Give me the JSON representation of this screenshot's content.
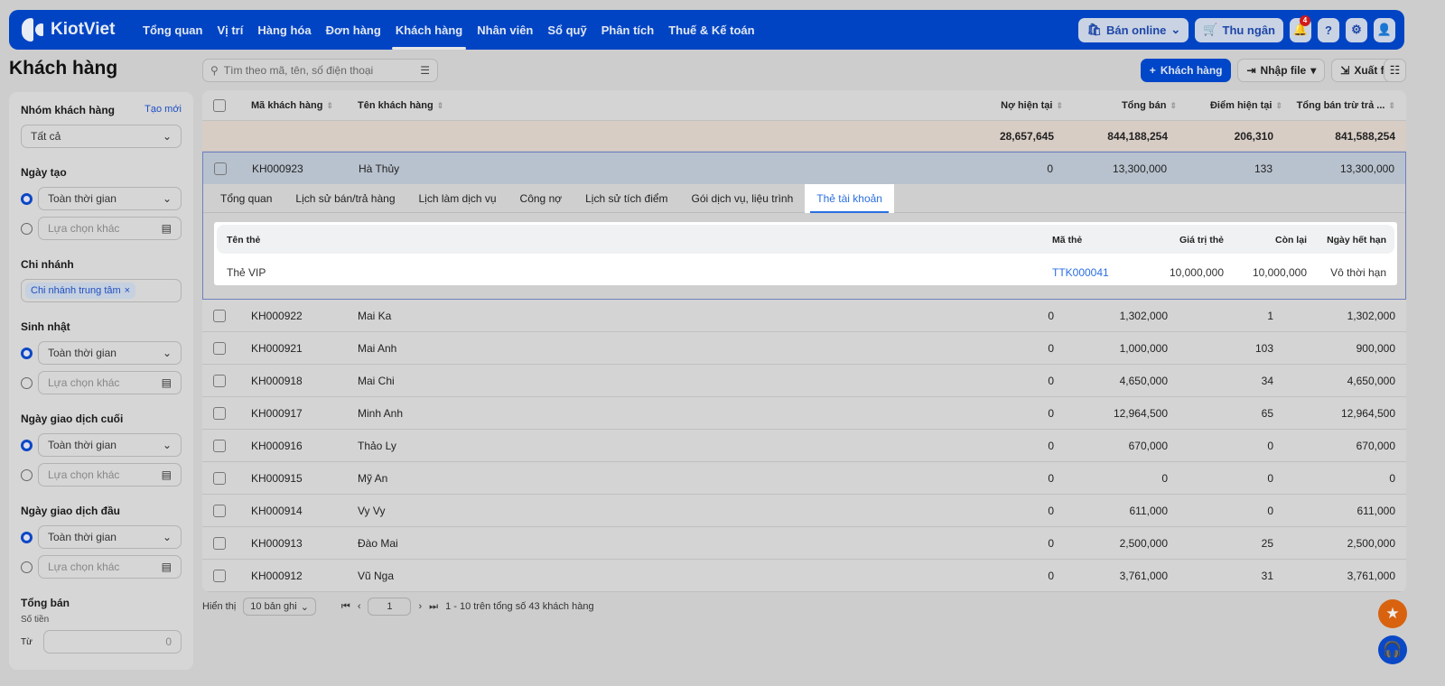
{
  "brand": "KiotViet",
  "nav": [
    "Tổng quan",
    "Vị trí",
    "Hàng hóa",
    "Đơn hàng",
    "Khách hàng",
    "Nhân viên",
    "Sổ quỹ",
    "Phân tích",
    "Thuế & Kế toán"
  ],
  "nav_active": "Khách hàng",
  "topright": {
    "online": "Bán online",
    "cashier": "Thu ngân",
    "notif_count": "4"
  },
  "page_title": "Khách hàng",
  "search": {
    "placeholder": "Tìm theo mã, tên, số điện thoại"
  },
  "actions": {
    "add": "Khách hàng",
    "import": "Nhập file",
    "export": "Xuất file"
  },
  "sidebar": {
    "group": {
      "title": "Nhóm khách hàng",
      "create": "Tạo mới",
      "value": "Tất cả"
    },
    "created": {
      "title": "Ngày tạo",
      "all": "Toàn thời gian",
      "other": "Lựa chọn khác"
    },
    "branch": {
      "title": "Chi nhánh",
      "tag": "Chi nhánh trung tâm"
    },
    "birthday": {
      "title": "Sinh nhật",
      "all": "Toàn thời gian",
      "other": "Lựa chọn khác"
    },
    "last_tx": {
      "title": "Ngày giao dịch cuối",
      "all": "Toàn thời gian",
      "other": "Lựa chọn khác"
    },
    "first_tx": {
      "title": "Ngày giao dịch đầu",
      "all": "Toàn thời gian",
      "other": "Lựa chọn khác"
    },
    "total": {
      "title": "Tổng bán",
      "sub": "Số tiền",
      "from": "Từ",
      "from_value": "0"
    }
  },
  "table": {
    "headers": [
      "Mã khách hàng",
      "Tên khách hàng",
      "Nợ hiện tại",
      "Tổng bán",
      "Điểm hiện tại",
      "Tổng bán trừ trả ..."
    ],
    "summary": [
      "28,657,645",
      "844,188,254",
      "206,310",
      "841,588,254"
    ],
    "selected": [
      "KH000923",
      "Hà Thủy",
      "0",
      "13,300,000",
      "133",
      "13,300,000"
    ],
    "rows": [
      [
        "KH000922",
        "Mai Ka",
        "0",
        "1,302,000",
        "1",
        "1,302,000"
      ],
      [
        "KH000921",
        "Mai Anh",
        "0",
        "1,000,000",
        "103",
        "900,000"
      ],
      [
        "KH000918",
        "Mai Chi",
        "0",
        "4,650,000",
        "34",
        "4,650,000"
      ],
      [
        "KH000917",
        "Minh Anh",
        "0",
        "12,964,500",
        "65",
        "12,964,500"
      ],
      [
        "KH000916",
        "Thảo Ly",
        "0",
        "670,000",
        "0",
        "670,000"
      ],
      [
        "KH000915",
        "Mỹ An",
        "0",
        "0",
        "0",
        "0"
      ],
      [
        "KH000914",
        "Vy Vy",
        "0",
        "611,000",
        "0",
        "611,000"
      ],
      [
        "KH000913",
        "Đào Mai",
        "0",
        "2,500,000",
        "25",
        "2,500,000"
      ],
      [
        "KH000912",
        "Vũ Nga",
        "0",
        "3,761,000",
        "31",
        "3,761,000"
      ]
    ]
  },
  "detail": {
    "tabs": [
      "Tổng quan",
      "Lịch sử bán/trả hàng",
      "Lịch làm dịch vụ",
      "Công nợ",
      "Lịch sử tích điểm",
      "Gói dịch vụ, liệu trình",
      "Thẻ tài khoản"
    ],
    "active_tab": "Thẻ tài khoản",
    "card_headers": [
      "Tên thẻ",
      "Mã thẻ",
      "Giá trị thẻ",
      "Còn lại",
      "Ngày hết hạn"
    ],
    "card_row": [
      "Thẻ VIP",
      "TTK000041",
      "10,000,000",
      "10,000,000",
      "Vô thời hạn"
    ]
  },
  "pager": {
    "show": "Hiển thị",
    "per_page": "10 bản ghi",
    "page": "1",
    "summary": "1 - 10 trên tổng số 43 khách hàng"
  },
  "colors": {
    "brand": "#0044c4",
    "link": "#2a6fe0",
    "fab_star": "#d9620f"
  }
}
